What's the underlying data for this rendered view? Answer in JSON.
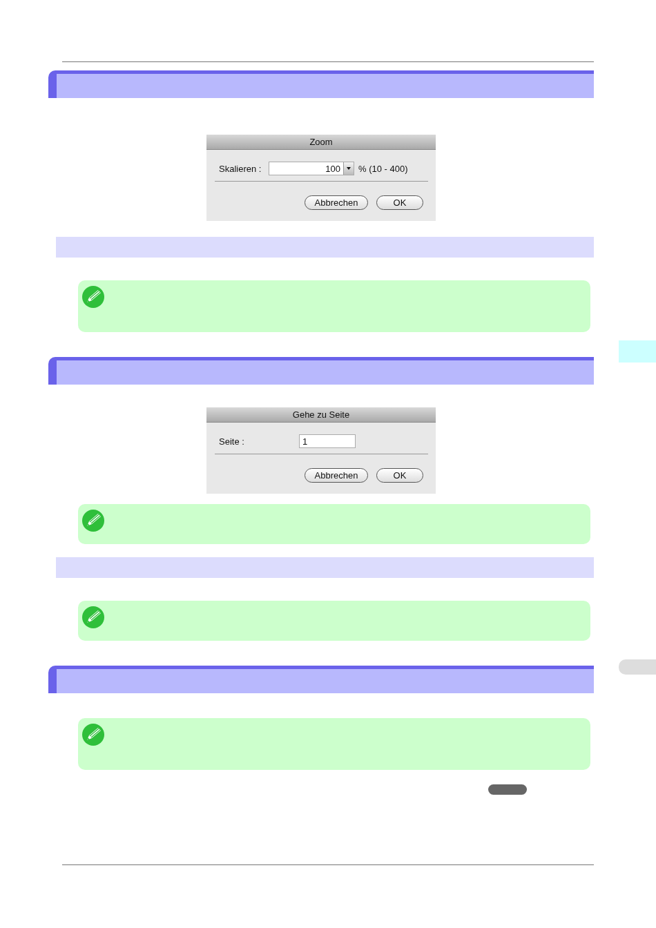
{
  "blocks": [
    {
      "kind": "section_header"
    },
    {
      "kind": "dialog",
      "title": "Zoom",
      "field": {
        "kind": "combo",
        "label": "Skalieren :",
        "value": "100",
        "suffix": "% (10 - 400)"
      },
      "buttons": [
        "Abbrechen",
        "OK"
      ]
    },
    {
      "kind": "subheader"
    },
    {
      "kind": "note"
    },
    {
      "kind": "section_header"
    },
    {
      "kind": "dialog",
      "title": "Gehe zu Seite",
      "field": {
        "kind": "text",
        "label": "Seite :",
        "value": "1"
      },
      "buttons": [
        "Abbrechen",
        "OK"
      ]
    },
    {
      "kind": "note"
    },
    {
      "kind": "subheader"
    },
    {
      "kind": "note"
    },
    {
      "kind": "section_header"
    },
    {
      "kind": "note"
    },
    {
      "kind": "pill"
    }
  ],
  "side_tabs": [
    {
      "selected": true
    },
    {
      "selected": false
    }
  ]
}
